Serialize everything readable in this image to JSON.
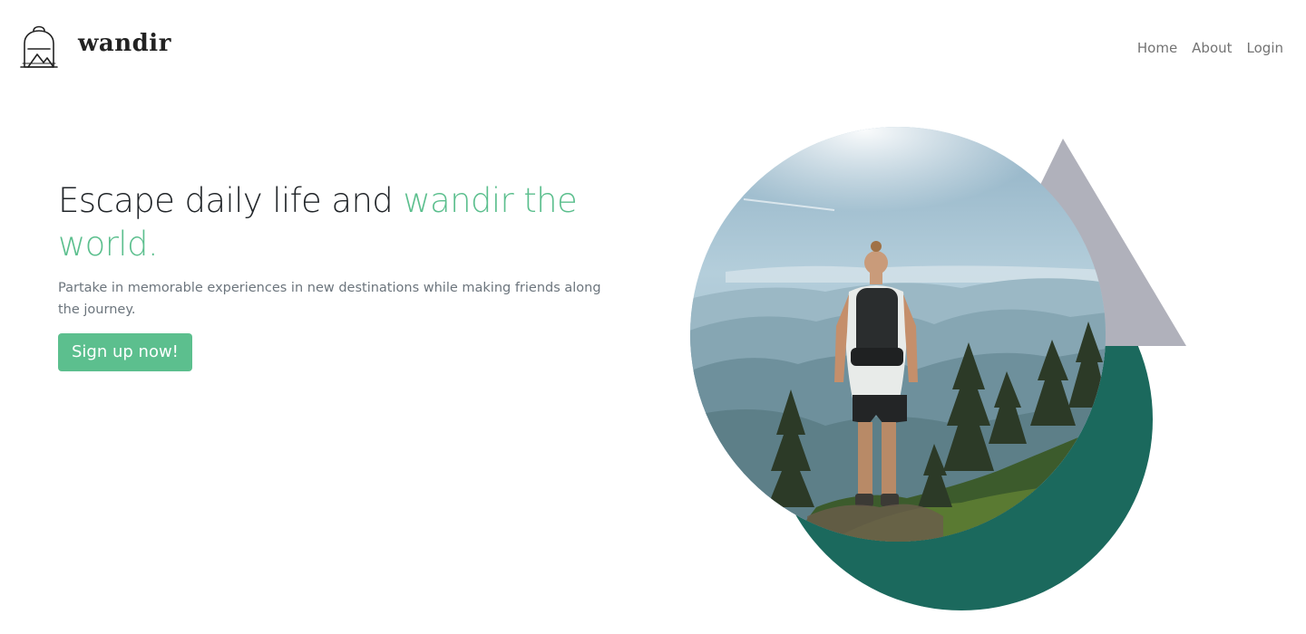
{
  "brand": {
    "name": "wandir",
    "logo_icon": "backpack-icon"
  },
  "nav": {
    "items": [
      {
        "label": "Home"
      },
      {
        "label": "About"
      },
      {
        "label": "Login"
      }
    ]
  },
  "hero": {
    "title_part1": "Escape daily life and ",
    "title_accent": "wandir the world.",
    "subtitle": "Partake in memorable experiences in new destinations while making friends along the journey.",
    "cta_label": "Sign up now!"
  },
  "colors": {
    "accent": "#5cbf8e",
    "dark_green": "#1b695d",
    "triangle_gray": "#b0b1bb",
    "text_dark": "#212529",
    "text_muted": "#6c757d",
    "nav_text": "#737373"
  }
}
